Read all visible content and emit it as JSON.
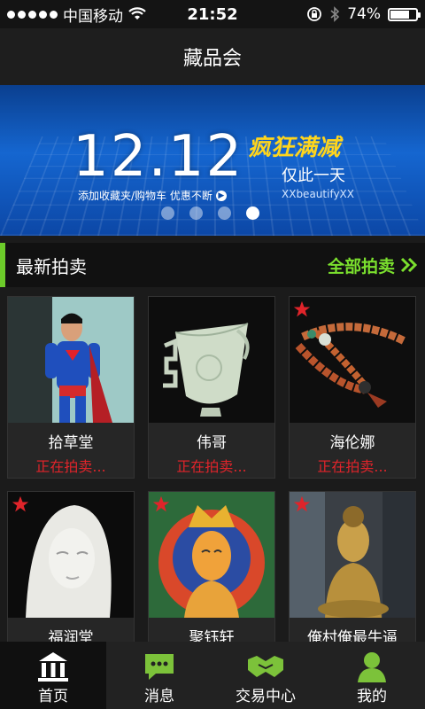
{
  "status": {
    "carrier": "中国移动",
    "time": "21:52",
    "battery": "74%",
    "battery_level": 0.74
  },
  "nav": {
    "title": "藏品会"
  },
  "banner": {
    "date": "12.12",
    "promo": "疯狂满减",
    "only": "仅此一天",
    "sub": "添加收藏夹/购物车  优惠不断",
    "brand": "XXbeautifyXX",
    "active_indicator": 3
  },
  "section": {
    "title": "最新拍卖",
    "more": "全部拍卖"
  },
  "items": [
    {
      "name": "拾草堂",
      "status": "正在拍卖...",
      "starred": false,
      "image": "superman-statue"
    },
    {
      "name": "伟哥",
      "status": "正在拍卖...",
      "starred": false,
      "image": "jade-cup"
    },
    {
      "name": "海伦娜",
      "status": "正在拍卖...",
      "starred": true,
      "image": "prayer-beads"
    },
    {
      "name": "福润堂",
      "status": "",
      "starred": true,
      "image": "porcelain-guanyin"
    },
    {
      "name": "聚钰轩",
      "status": "",
      "starred": true,
      "image": "thangka-painting"
    },
    {
      "name": "俺村俺最牛逼",
      "status": "",
      "starred": true,
      "image": "bronze-buddha"
    }
  ],
  "tabs": [
    {
      "label": "首页",
      "icon": "home-icon",
      "active": true
    },
    {
      "label": "消息",
      "icon": "message-icon",
      "active": false
    },
    {
      "label": "交易中心",
      "icon": "handshake-icon",
      "active": false
    },
    {
      "label": "我的",
      "icon": "user-icon",
      "active": false
    }
  ],
  "colors": {
    "accent": "#6ccb2a",
    "status_red": "#e0242a",
    "banner_blue": "#1566d0"
  }
}
